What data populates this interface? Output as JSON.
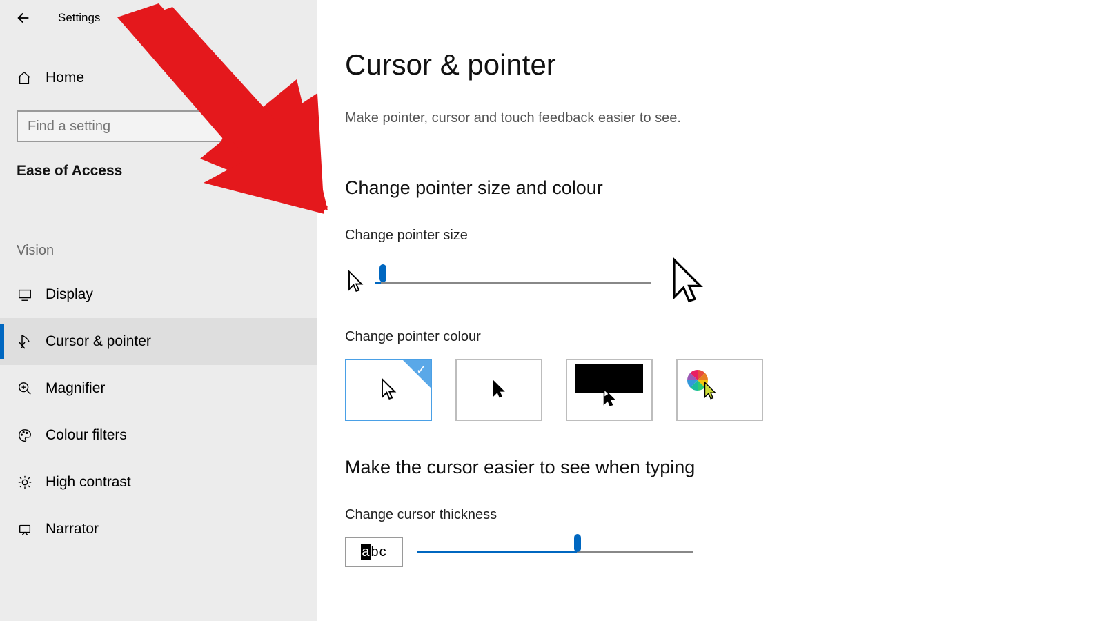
{
  "colors": {
    "accent": "#0067c0",
    "sidebar_bg": "#ececec",
    "nav_active_bg": "#dedede",
    "selected_border": "#4aa0e6",
    "border_gray": "#bdbdbd"
  },
  "top": {
    "title": "Settings"
  },
  "sidebar": {
    "home": "Home",
    "search_placeholder": "Find a setting",
    "category": "Ease of Access",
    "section": "Vision",
    "items": [
      {
        "id": "display",
        "label": "Display"
      },
      {
        "id": "cursor-pointer",
        "label": "Cursor & pointer"
      },
      {
        "id": "magnifier",
        "label": "Magnifier"
      },
      {
        "id": "colour-filters",
        "label": "Colour filters"
      },
      {
        "id": "high-contrast",
        "label": "High contrast"
      },
      {
        "id": "narrator",
        "label": "Narrator"
      }
    ],
    "active_id": "cursor-pointer"
  },
  "main": {
    "title": "Cursor & pointer",
    "subtitle": "Make pointer, cursor and touch feedback easier to see.",
    "section1_heading": "Change pointer size and colour",
    "pointer_size_label": "Change pointer size",
    "pointer_colour_label": "Change pointer colour",
    "section2_heading": "Make the cursor easier to see when typing",
    "cursor_thickness_label": "Change cursor thickness",
    "abc_sample": "abc",
    "pointer_size_value_percent": 2,
    "cursor_thickness_value_percent": 58,
    "colour_options": [
      {
        "id": "white",
        "selected": true
      },
      {
        "id": "black",
        "selected": false
      },
      {
        "id": "inverted",
        "selected": false
      },
      {
        "id": "custom",
        "selected": false
      }
    ]
  }
}
